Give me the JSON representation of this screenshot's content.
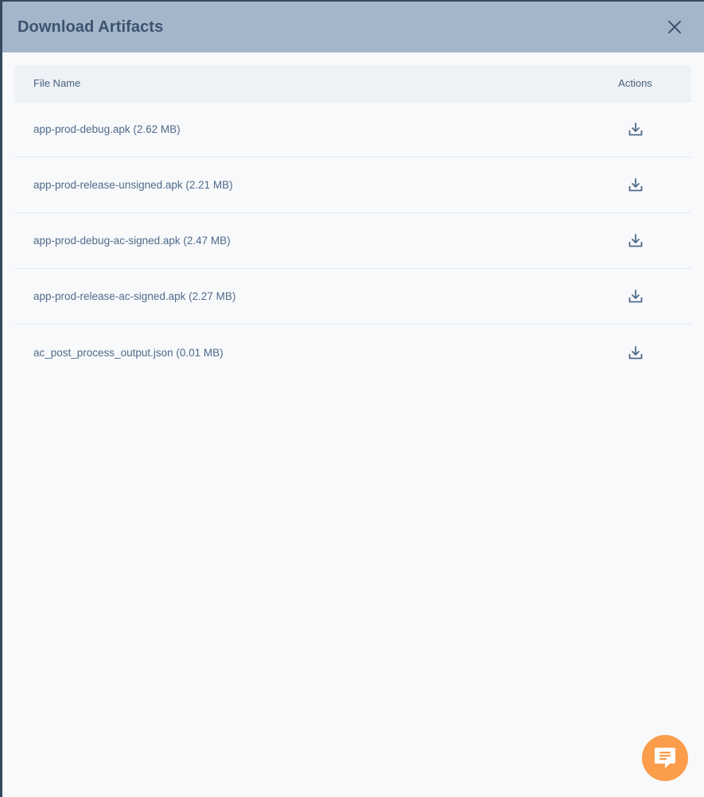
{
  "modal": {
    "title": "Download Artifacts",
    "close_icon": "close-icon"
  },
  "table": {
    "columns": [
      "File Name",
      "Actions"
    ],
    "rows": [
      {
        "name": "app-prod-debug.apk (2.62 MB)",
        "action_icon": "download-icon"
      },
      {
        "name": "app-prod-release-unsigned.apk (2.21 MB)",
        "action_icon": "download-icon"
      },
      {
        "name": "app-prod-debug-ac-signed.apk (2.47 MB)",
        "action_icon": "download-icon"
      },
      {
        "name": "app-prod-release-ac-signed.apk (2.27 MB)",
        "action_icon": "download-icon"
      },
      {
        "name": "ac_post_process_output.json (0.01 MB)",
        "action_icon": "download-icon"
      }
    ]
  },
  "chat_widget": {
    "icon": "chat-icon",
    "color": "#fb9d4b"
  },
  "colors": {
    "header_bg": "#a6b6ca",
    "title": "#3c5370",
    "text": "#4f6a8a",
    "accent": "#fb9d4b"
  }
}
